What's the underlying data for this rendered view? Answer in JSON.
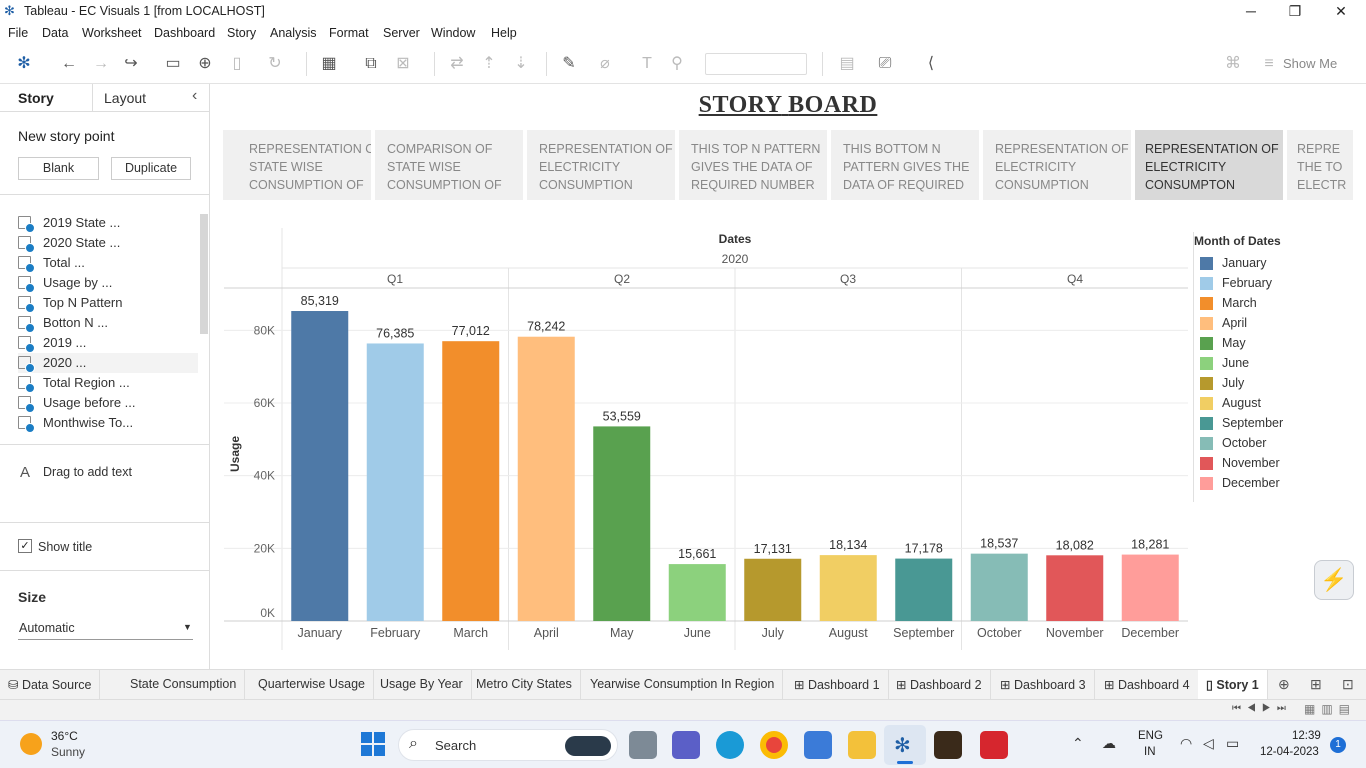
{
  "window": {
    "title": "Tableau - EC Visuals 1 [from LOCALHOST]",
    "minimize": "─",
    "restore": "❐",
    "close": "✕"
  },
  "menu": [
    "File",
    "Data",
    "Worksheet",
    "Dashboard",
    "Story",
    "Analysis",
    "Format",
    "Server",
    "Window",
    "Help"
  ],
  "toolbar": {
    "show_me": "Show Me"
  },
  "left_pane": {
    "tab_story": "Story",
    "tab_layout": "Layout",
    "new_story_point": "New story point",
    "blank": "Blank",
    "duplicate": "Duplicate",
    "sheets": [
      "2019 State ...",
      "2020 State ...",
      "Total ...",
      "Usage by ...",
      "Top N Pattern",
      "Botton N ...",
      "2019 ...",
      "2020 ...",
      "Total Region ...",
      "Usage before ...",
      "Monthwise To..."
    ],
    "drag_text": "Drag to add text",
    "show_title": "Show title",
    "size_label": "Size",
    "size_value": "Automatic"
  },
  "story": {
    "title_1": "STORY",
    "title_2": "BOARD",
    "points": [
      [
        "REPRESENTATION OF",
        "STATE WISE",
        "CONSUMPTION OF"
      ],
      [
        "COMPARISON OF",
        "STATE WISE",
        "CONSUMPTION OF"
      ],
      [
        "REPRESENTATION OF",
        "ELECTRICITY",
        "CONSUMPTION"
      ],
      [
        "THIS TOP N PATTERN",
        "GIVES THE DATA OF",
        "REQUIRED NUMBER"
      ],
      [
        "THIS BOTTOM N",
        "PATTERN GIVES THE",
        "DATA OF REQUIRED"
      ],
      [
        "REPRESENTATION OF",
        "ELECTRICITY",
        "CONSUMPTION"
      ],
      [
        "REPRESENTATION OF",
        "ELECTRICITY",
        "CONSUMPTON"
      ],
      [
        "REPRE",
        "THE TO",
        "ELECTR"
      ]
    ]
  },
  "chart_data": {
    "type": "bar",
    "header": "Dates",
    "year": "2020",
    "quarters": [
      "Q1",
      "Q2",
      "Q3",
      "Q4"
    ],
    "categories": [
      "January",
      "February",
      "March",
      "April",
      "May",
      "June",
      "July",
      "August",
      "September",
      "October",
      "November",
      "December"
    ],
    "values": [
      85319,
      76385,
      77012,
      78242,
      53559,
      15661,
      17131,
      18134,
      17178,
      18537,
      18082,
      18281
    ],
    "value_labels": [
      "85,319",
      "76,385",
      "77,012",
      "78,242",
      "53,559",
      "15,661",
      "17,131",
      "18,134",
      "17,178",
      "18,537",
      "18,082",
      "18,281"
    ],
    "ylabel": "Usage",
    "yticks": [
      "0K",
      "20K",
      "40K",
      "60K",
      "80K"
    ],
    "ytick_values": [
      0,
      20000,
      40000,
      60000,
      80000
    ],
    "ylim": [
      0,
      90000
    ],
    "legend_title": "Month of Dates",
    "legend_position": "right",
    "colors": [
      "#4e79a7",
      "#a0cbe8",
      "#f28e2b",
      "#ffbe7d",
      "#59a14f",
      "#8cd17d",
      "#b6992d",
      "#f1ce63",
      "#499894",
      "#86bcb6",
      "#e15759",
      "#ff9d9a"
    ],
    "grid": true
  },
  "sheet_tabs": [
    "Data Source",
    "State Consumption",
    "Quarterwise Usage",
    "Usage By Year",
    "Metro City States",
    "Yearwise Consumption In Region",
    "Dashboard 1",
    "Dashboard 2",
    "Dashboard 3",
    "Dashboard 4",
    "Story 1"
  ],
  "taskbar": {
    "weather_temp": "36°C",
    "weather_desc": "Sunny",
    "search": "Search",
    "lang_1": "ENG",
    "lang_2": "IN",
    "time": "12:39",
    "date": "12-04-2023",
    "notif_count": "1"
  }
}
